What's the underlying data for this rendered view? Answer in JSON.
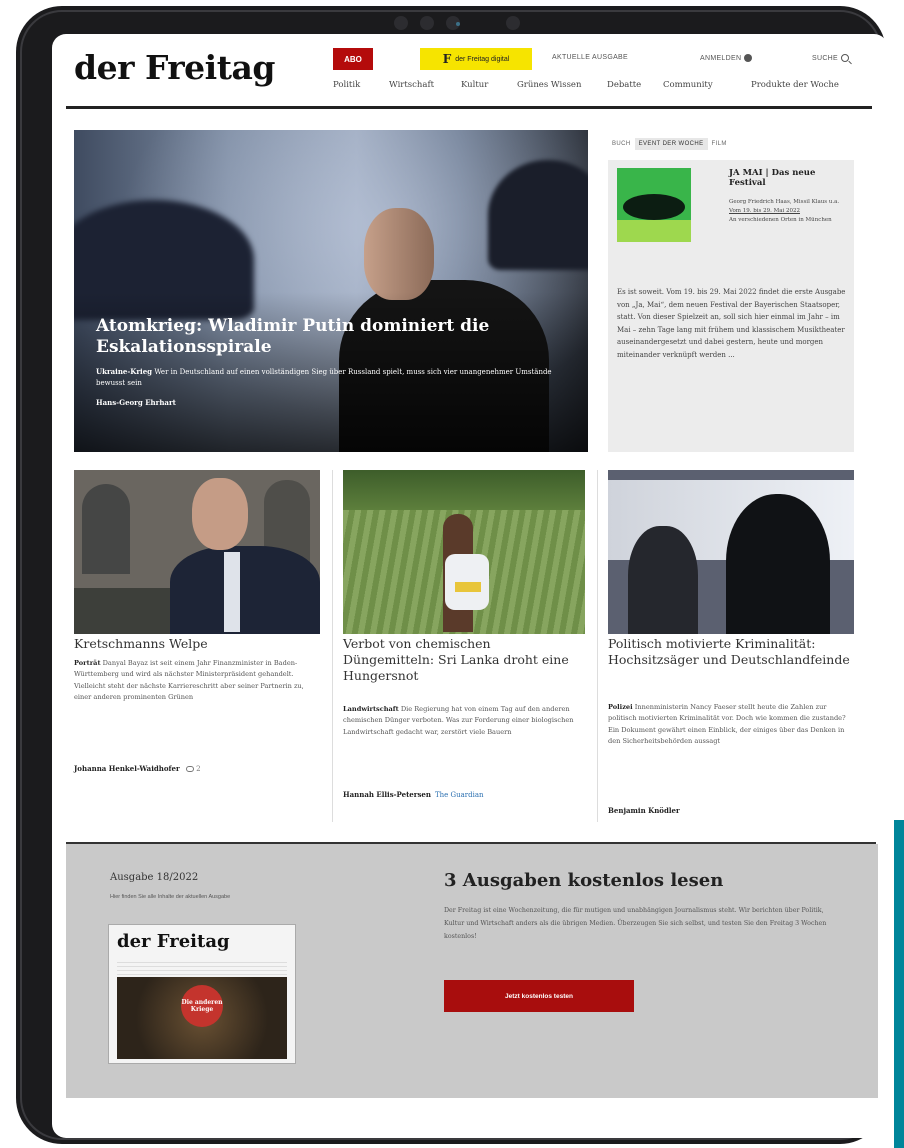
{
  "header": {
    "logo": "der Freitag",
    "abo_label": "ABO",
    "digital_icon": "F",
    "digital_label": "der Freitag digital",
    "top_links": [
      "AKTUELLE AUSGABE",
      "ANMELDEN",
      "SUCHE"
    ],
    "nav": [
      "Politik",
      "Wirtschaft",
      "Kultur",
      "Grünes Wissen",
      "Debatte",
      "Community",
      "Produkte der Woche"
    ]
  },
  "hero": {
    "title": "Atomkrieg: Wladimir Putin dominiert die Eskalationsspirale",
    "kicker": "Ukraine-Krieg",
    "teaser": "Wer in Deutschland auf einen vollständigen Sieg über Russland spielt, muss sich vier unangenehmer Umstände bewusst sein",
    "author": "Hans-Georg Ehrhart"
  },
  "sidebox": {
    "tabs": [
      "BUCH",
      "EVENT DER WOCHE",
      "FILM"
    ],
    "active_tab": "EVENT DER WOCHE",
    "title": "JA MAI | Das neue Festival",
    "meta1": "Georg Friedrich Haas, Missil Klaus u.a.",
    "meta2": "Vom 19. bis 29. Mai 2022",
    "meta3": "An verschiedenen Orten in München",
    "text": "Es ist soweit. Vom 19. bis 29. Mai 2022 findet die erste Ausgabe von „Ja, Mai“, dem neuen Festival der Bayerischen Staatsoper, statt. Von dieser Spielzeit an, soll sich hier einmal im Jahr – im Mai – zehn Tage lang mit frühem und klassischem Musiktheater auseinandergesetzt und dabei gestern, heute und morgen miteinander verknüpft werden ..."
  },
  "articles": [
    {
      "title": "Kretschmanns Welpe",
      "kicker": "Porträt",
      "text": "Danyal Bayaz ist seit einem Jahr Finanzminister in Baden-Württemberg und wird als nächster Ministerpräsident gehandelt. Vielleicht steht der nächste Karriereschritt aber seiner Partnerin zu, einer anderen prominenten Grünen",
      "author": "Johanna Henkel-Waidhofer",
      "comments": "2"
    },
    {
      "title": "Verbot von chemischen Düngemitteln: Sri Lanka droht eine Hungersnot",
      "kicker": "Landwirtschaft",
      "text": "Die Regierung hat von einem Tag auf den anderen chemischen Dünger verboten. Was zur Forderung einer biologischen Landwirtschaft gedacht war, zerstört viele Bauern",
      "author": "Hannah Ellis-Petersen",
      "source": "The Guardian"
    },
    {
      "title": "Politisch motivierte Kriminalität: Hochsitzsäger und Deutschlandfeinde",
      "kicker": "Polizei",
      "text": "Innenministerin Nancy Faeser stellt heute die Zahlen zur politisch motivierten Kriminalität vor. Doch wie kommen die zustande? Ein Dokument gewährt einen Einblick, der einiges über das Denken in den Sicherheitsbehörden aussagt",
      "author": "Benjamin Knödler"
    }
  ],
  "bottom": {
    "issue_label": "Ausgabe 18/2022",
    "issue_sub": "Hier finden Sie alle Inhalte der aktuellen Ausgabe",
    "mag_logo": "der Freitag",
    "mag_badge": "Die anderen Kriege",
    "promo_title": "3 Ausgaben kostenlos lesen",
    "promo_text": "Der Freitag ist eine Wochenzeitung, die für mutigen und unabhängigen Journalismus steht. Wir berichten über Politik, Kultur und Wirtschaft anders als die übrigen Medien. Überzeugen Sie sich selbst, und testen Sie den Freitag 3 Wochen kostenlos!",
    "cta_label": "Jetzt kostenlos testen"
  }
}
